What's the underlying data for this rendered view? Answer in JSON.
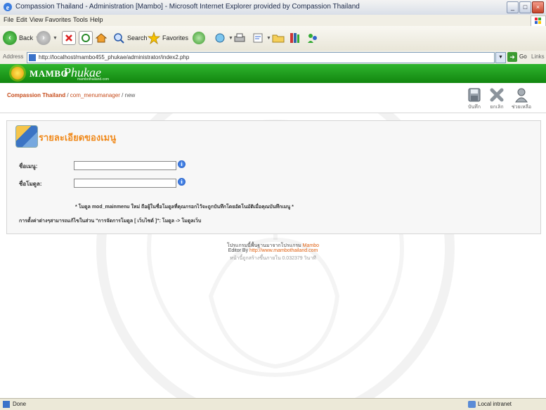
{
  "window": {
    "title": "Compassion Thailand - Administration [Mambo] - Microsoft Internet Explorer provided by Compassion Thailand",
    "minimize": "_",
    "maximize": "□",
    "close": "×"
  },
  "menubar": {
    "items": [
      "File",
      "Edit",
      "View",
      "Favorites",
      "Tools",
      "Help"
    ]
  },
  "toolbar": {
    "back_label": "Back",
    "search_label": "Search",
    "favorites_label": "Favorites",
    "back_icon": "back-arrow-icon",
    "forward_icon": "forward-arrow-icon"
  },
  "address": {
    "label": "Address",
    "url": "http://localhost/mambo455_phukae/administrator/index2.php",
    "go_label": "Go",
    "links_label": "Links"
  },
  "site": {
    "logo_main": "MAMBO",
    "logo_script": "Phukae",
    "logo_sub": "mambothailand.com"
  },
  "pathway": {
    "site": "Compassion Thailand",
    "sep": " / ",
    "component": "com_menumanager",
    "page": "new"
  },
  "actions": [
    {
      "label": "บันทึก",
      "icon": "save-icon"
    },
    {
      "label": "ยกเลิก",
      "icon": "cancel-icon"
    },
    {
      "label": "ช่วยเหลือ",
      "icon": "help-icon"
    }
  ],
  "form": {
    "heading": "รายละเอียดของเมนู",
    "menu_name_label": "ชื่อเมนู:",
    "menu_name_value": "",
    "module_name_label": "ชื่อโมดูล:",
    "module_name_value": "",
    "info_glyph": "i",
    "note1": "* โมดูล mod_mainmenu ใหม่ ถือผู้ในชื่อโมดูลที่คุณกรอกไว้จะถูกบันทึกโดยอัตโนมัติเมื่อคุณบันทึกเมนู *",
    "note2": "การตั้งค่าต่างๆสามารถแก้ไขในส่วน \"การจัดการโมดูล [ เว็บไซต์ ]\": โมดูล -> โมดูลเว็บ"
  },
  "footer": {
    "line1_text": "โปรแกรมนี้พื้นฐานมาจากโปรแกรม ",
    "line1_link": "Mambo",
    "line2_text": "Editor By ",
    "line2_link": "http://www.mambothailand.com",
    "line3": "หน้านี้ถูกสร้างขึ้นภายใน 0.032379 วินาที"
  },
  "status": {
    "text": "Done",
    "zone": "Local intranet"
  }
}
